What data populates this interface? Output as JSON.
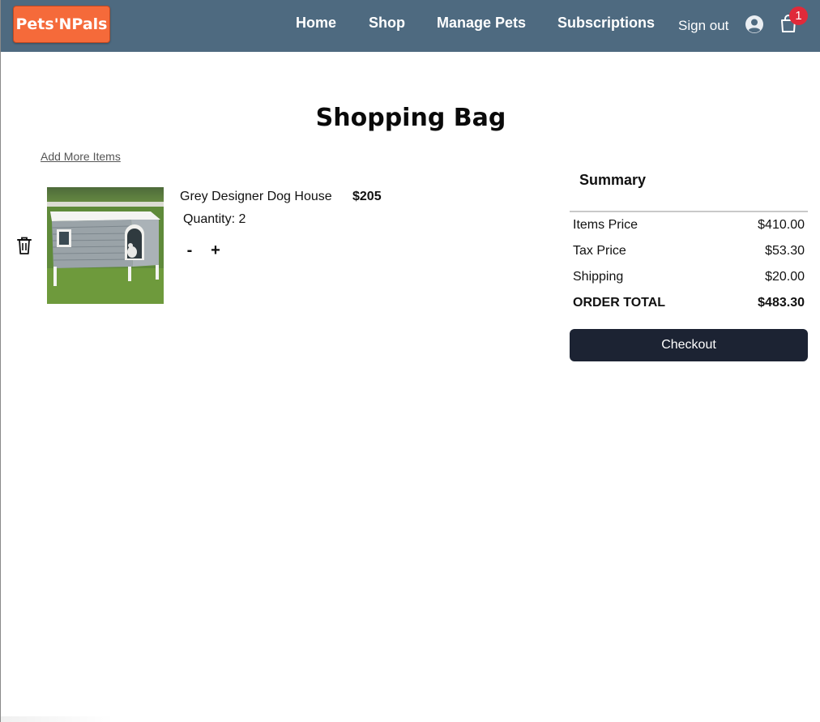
{
  "header": {
    "logo": "Pets'NPals",
    "nav": [
      {
        "label": "Home"
      },
      {
        "label": "Shop"
      },
      {
        "label": "Manage Pets"
      },
      {
        "label": "Subscriptions"
      }
    ],
    "sign_out": "Sign out",
    "cart_count": "1",
    "icons": {
      "user": "user-circle-icon",
      "cart": "shopping-bag-icon"
    },
    "colors": {
      "navbar": "#4e6a80",
      "logo": "#f56a3a",
      "badge": "#e02a3a"
    }
  },
  "main": {
    "title": "Shopping Bag",
    "add_more": "Add More Items",
    "items": [
      {
        "name": "Grey Designer Dog House",
        "price": "$205",
        "quantity_label": "Quantity: 2",
        "decrement": "-",
        "increment": "+",
        "delete_icon": "trash-icon",
        "image": "dog-house-image"
      }
    ]
  },
  "summary": {
    "title": "Summary",
    "rows": [
      {
        "label": "Items Price",
        "value": "$410.00"
      },
      {
        "label": "Tax Price",
        "value": "$53.30"
      },
      {
        "label": "Shipping",
        "value": "$20.00"
      },
      {
        "label": "ORDER TOTAL",
        "value": "$483.30"
      }
    ],
    "checkout": "Checkout",
    "checkout_color": "#1c2333"
  }
}
